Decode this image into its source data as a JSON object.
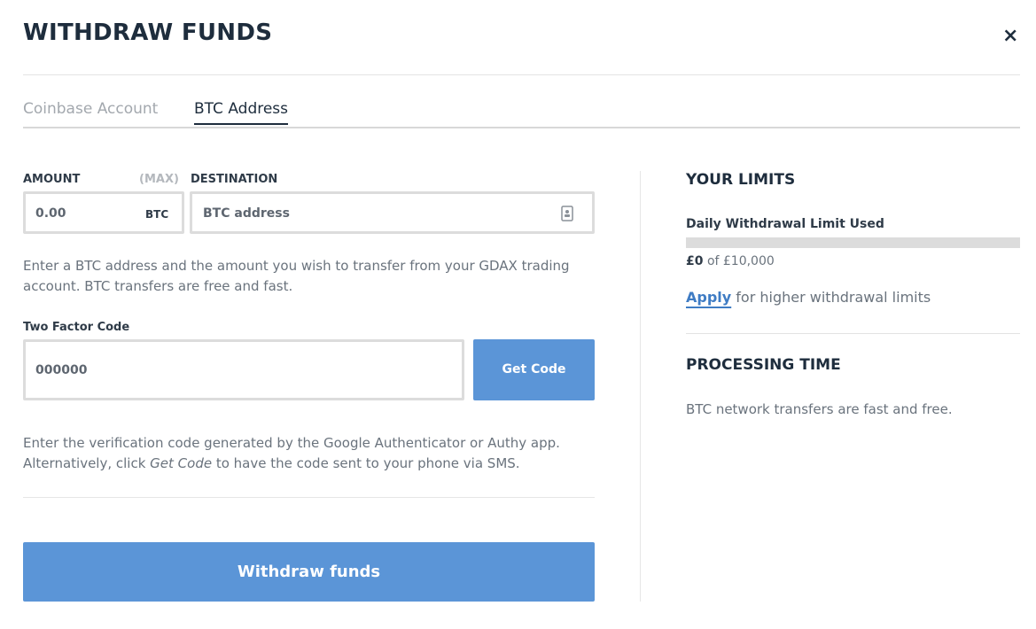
{
  "dialog": {
    "title": "WITHDRAW FUNDS",
    "close_symbol": "×"
  },
  "tabs": [
    {
      "label": "Coinbase Account",
      "active": false
    },
    {
      "label": "BTC Address",
      "active": true
    }
  ],
  "form": {
    "amount_label": "AMOUNT",
    "max_label": "(MAX)",
    "amount_placeholder": "0.00",
    "amount_unit": "BTC",
    "destination_label": "DESTINATION",
    "destination_placeholder": "BTC address",
    "help_text": "Enter a BTC address and the amount you wish to transfer from your GDAX trading account. BTC transfers are free and fast.",
    "two_factor_label": "Two Factor Code",
    "two_factor_placeholder": "000000",
    "get_code_label": "Get Code",
    "verification_help_1": "Enter the verification code generated by the Google Authenticator or Authy app.",
    "verification_help_2a": "Alternatively, click ",
    "verification_help_2b": "Get Code",
    "verification_help_2c": " to have the code sent to your phone via SMS.",
    "submit_label": "Withdraw funds"
  },
  "limits": {
    "heading": "YOUR LIMITS",
    "daily_label": "Daily Withdrawal Limit Used",
    "used_fraction": 0,
    "used": "£0",
    "of_text": "of £10,000",
    "apply_link": "Apply",
    "apply_rest": "for higher withdrawal limits"
  },
  "processing": {
    "heading": "PROCESSING TIME",
    "text": "BTC network transfers are fast and free."
  },
  "colors": {
    "primary": "#5b95d7",
    "link": "#3f7cc4",
    "text_dark": "#1e2d3d"
  },
  "icons": {
    "address_book": "address-book-icon",
    "close": "close-icon"
  }
}
